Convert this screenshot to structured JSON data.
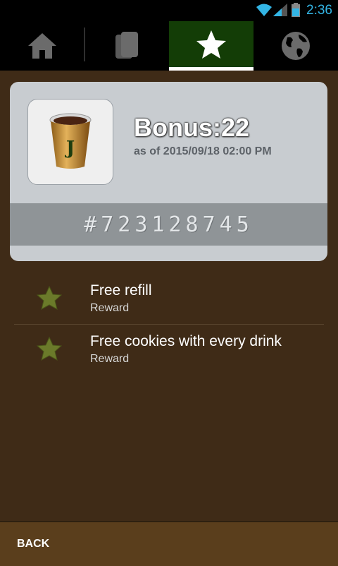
{
  "status_bar": {
    "time": "2:36"
  },
  "tabs": [
    {
      "icon": "home-icon",
      "active": false
    },
    {
      "icon": "cards-icon",
      "active": false
    },
    {
      "icon": "star-icon",
      "active": true
    },
    {
      "icon": "globe-icon",
      "active": false
    }
  ],
  "card": {
    "logo": "coffee-cup-logo",
    "bonus": "Bonus:22",
    "as_of": "as of 2015/09/18 02:00 PM",
    "number": "#723128745"
  },
  "rewards": [
    {
      "title": "Free refill",
      "subtitle": "Reward"
    },
    {
      "title": "Free cookies with every drink",
      "subtitle": "Reward"
    }
  ],
  "bottom_bar": {
    "back_label": "BACK"
  },
  "colors": {
    "background": "#3f2b17",
    "active_tab": "#133d06",
    "status_accent": "#33b5e5",
    "card": "#c8ccd0",
    "bottom_bar": "#5a3e1c"
  }
}
